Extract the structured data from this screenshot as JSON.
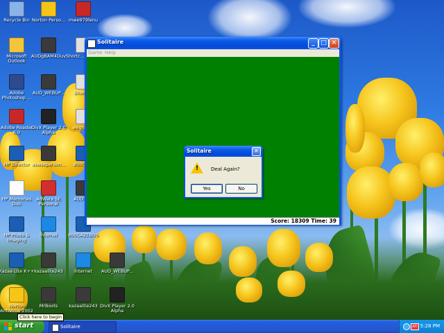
{
  "desktop": {
    "icons": [
      {
        "label": "Recycle Bin",
        "color": "#8ab4e8"
      },
      {
        "label": "Norton Perso...",
        "color": "#f5c518"
      },
      {
        "label": "mwe979lenu",
        "color": "#c62828"
      },
      {
        "label": "Microsoft Outlook",
        "color": "#f2c53d"
      },
      {
        "label": "AUDgBAM4Duv",
        "color": "#3a3a3a"
      },
      {
        "label": "Shortc... Com...",
        "color": "#e0e0e0"
      },
      {
        "label": "Adobe Photoshop ...",
        "color": "#2e4a8f"
      },
      {
        "label": "AUD_WEBUP...",
        "color": "#3a3a3a"
      },
      {
        "label": "Shortc...",
        "color": "#e0e0e0"
      },
      {
        "label": "Adobe Reader 6.0",
        "color": "#c62828"
      },
      {
        "label": "DivX Player 2.0 Alpha",
        "color": "#222222"
      },
      {
        "label": "wegnex...",
        "color": "#e0e0e0"
      },
      {
        "label": "HP Director",
        "color": "#1b5fb5"
      },
      {
        "label": "aswseperson...",
        "color": "#3a3a3a"
      },
      {
        "label": "800GA...",
        "color": "#1b5fb5"
      },
      {
        "label": "HP Memories Disc",
        "color": "#ffffff"
      },
      {
        "label": "AdWare SE Personal",
        "color": "#d32f2f"
      },
      {
        "label": "AUD_E...",
        "color": "#3a3a3a"
      },
      {
        "label": "HP Photo & Imaging",
        "color": "#1b5fb5"
      },
      {
        "label": "Internet",
        "color": "#1e88e5"
      },
      {
        "label": "800GAZEBOS",
        "color": "#1b5fb5"
      },
      {
        "label": "Kazaa Lite K++",
        "color": "#1b5fb5"
      },
      {
        "label": "kazaalite243",
        "color": "#3a3a3a"
      },
      {
        "label": "Internet",
        "color": "#1e88e5"
      },
      {
        "label": "AUD_WEBUP...",
        "color": "#3a3a3a"
      },
      {
        "label": "Norton AntiVirus 2002",
        "color": "#f5c518"
      },
      {
        "label": "MrBoots",
        "color": "#3a3a3a"
      },
      {
        "label": "kazaalite243",
        "color": "#3a3a3a"
      },
      {
        "label": "DivX Player 2.0 Alpha",
        "color": "#222222"
      }
    ]
  },
  "window": {
    "title": "Solitaire",
    "menu": [
      "Game",
      "Help"
    ],
    "minimize": "_",
    "maximize": "□",
    "close": "✕",
    "felt_color": "#008000",
    "status": "Score: 18309 Time: 39"
  },
  "dialog": {
    "title": "Solitaire",
    "close": "✕",
    "icon": "warning-icon",
    "icon_glyph": "!",
    "message": "Deal Again?",
    "yes_label": "Yes",
    "no_label": "No"
  },
  "taskbar": {
    "start_label": "start",
    "task_label": "Solitaire",
    "tray_badge": "ATI",
    "clock": "5:28 PM",
    "tooltip": "Click here to begin"
  }
}
